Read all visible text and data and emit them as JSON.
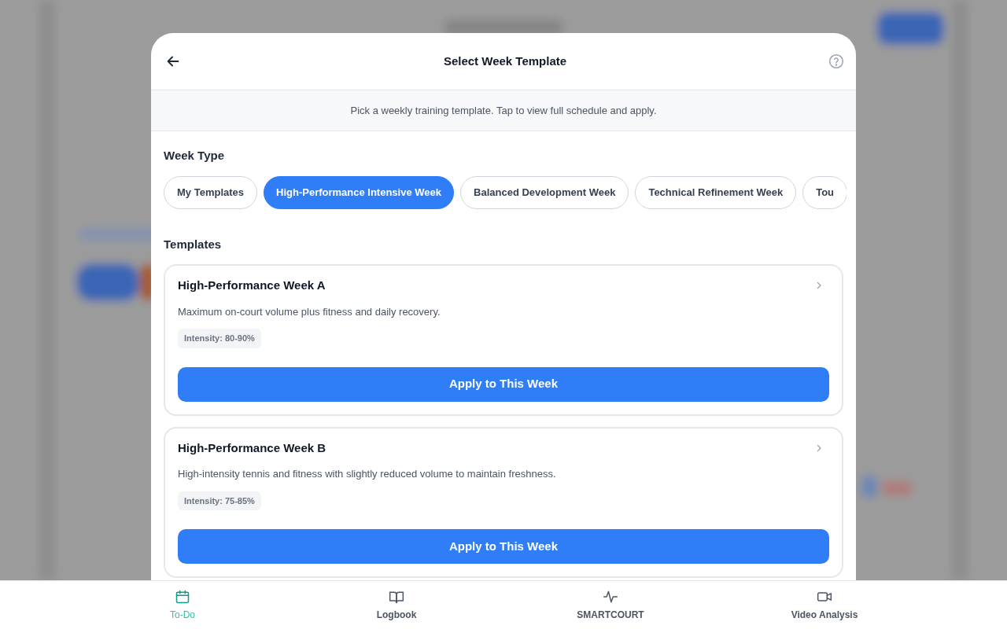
{
  "dialog": {
    "title": "Select Week Template",
    "subtitle": "Pick a weekly training template. Tap to view full schedule and apply."
  },
  "week_type": {
    "label": "Week Type",
    "chips": [
      {
        "label": "My Templates",
        "selected": false
      },
      {
        "label": "High-Performance Intensive Week",
        "selected": true
      },
      {
        "label": "Balanced Development Week",
        "selected": false
      },
      {
        "label": "Technical Refinement Week",
        "selected": false
      },
      {
        "label": "Tou",
        "selected": false
      }
    ]
  },
  "templates": {
    "label": "Templates",
    "cards": [
      {
        "title": "High-Performance Week A",
        "description": "Maximum on-court volume plus fitness and daily recovery.",
        "intensity": "Intensity: 80-90%",
        "button": "Apply to This Week"
      },
      {
        "title": "High-Performance Week B",
        "description": "High-intensity tennis and fitness with slightly reduced volume to maintain freshness.",
        "intensity": "Intensity: 75-85%",
        "button": "Apply to This Week"
      }
    ]
  },
  "bottom_nav": [
    {
      "label": "To-Do",
      "selected": true
    },
    {
      "label": "Logbook",
      "selected": false
    },
    {
      "label": "SMARTCOURT",
      "selected": false
    },
    {
      "label": "Video Analysis",
      "selected": false
    }
  ]
}
